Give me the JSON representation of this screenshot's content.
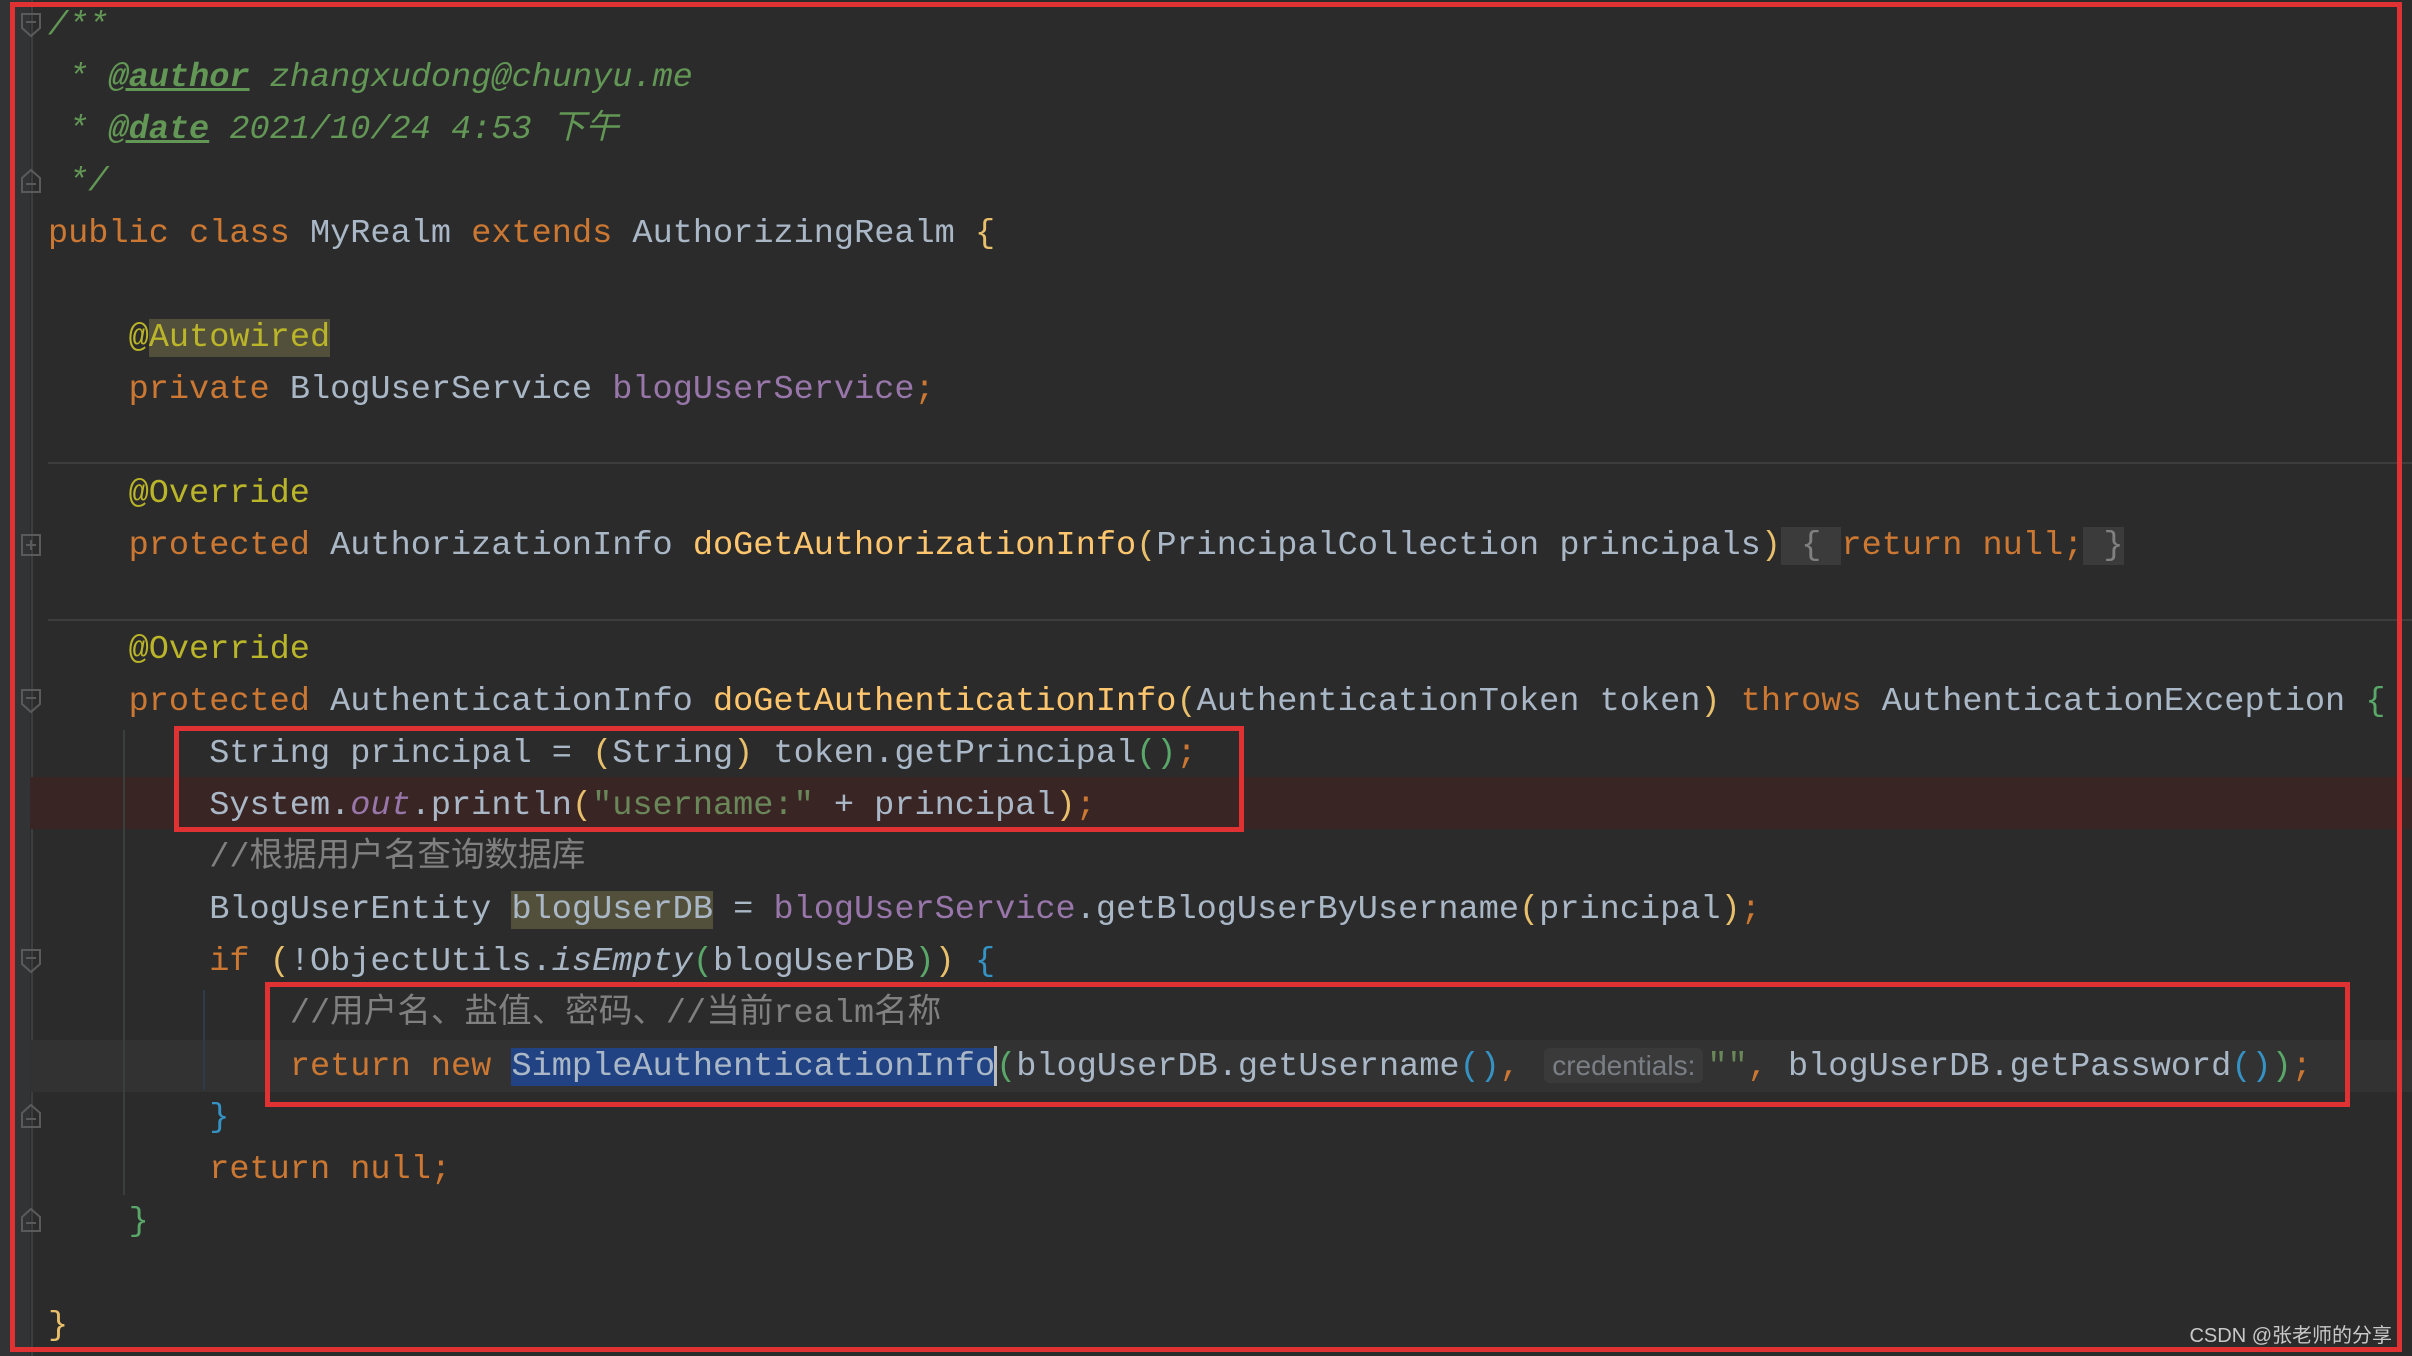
{
  "editor": {
    "theme": "IntelliJ Darcula",
    "lines": {
      "l1": "/**",
      "l2_star": " * ",
      "l2_tag": "@author",
      "l2_val": " zhangxudong@chunyu.me",
      "l3_star": " * ",
      "l3_tag": "@date",
      "l3_val": " 2021/10/24 4:53 下午",
      "l4": " */",
      "l5_public": "public",
      "l5_class": "class",
      "l5_name": "MyRealm",
      "l5_extends": "extends",
      "l5_super": "AuthorizingRealm",
      "l5_brace": "{",
      "l7_at": "@",
      "l7_ann": "Autowired",
      "l8_private": "private",
      "l8_type": "BlogUserService",
      "l8_field": "blogUserService",
      "l8_semi": ";",
      "l10_ann": "@Override",
      "l11_protected": "protected",
      "l11_type": "AuthorizationInfo",
      "l11_method": "doGetAuthorizationInfo",
      "l11_params": "PrincipalCollection principals",
      "l11_fold_open": " { ",
      "l11_body": "return null;",
      "l11_fold_close": " }",
      "l13_ann": "@Override",
      "l14_protected": "protected",
      "l14_type": "AuthenticationInfo",
      "l14_method": "doGetAuthenticationInfo",
      "l14_params": "AuthenticationToken token",
      "l14_throws": "throws",
      "l14_exc": "AuthenticationException",
      "l14_brace": "{",
      "l15_a": "String principal = ",
      "l15_cast": "String",
      "l15_b": " token.getPrincipal",
      "l16_a": "System.",
      "l16_out": "out",
      "l16_b": ".println",
      "l16_str": "\"username:\"",
      "l16_c": " + principal",
      "l17_cmt": "//根据用户名查询数据库",
      "l18_type": "BlogUserEntity ",
      "l18_var": "blogUserDB",
      "l18_eq": " = ",
      "l18_field": "blogUserService",
      "l18_call": ".getBlogUserByUsername",
      "l18_arg": "principal",
      "l19_if": "if",
      "l19_a": "!ObjectUtils.",
      "l19_isEmpty": "isEmpty",
      "l19_arg": "blogUserDB",
      "l20_cmt": "//用户名、盐值、密码、//当前realm名称",
      "l21_return": "return",
      "l21_new": "new",
      "l21_cls": "SimpleAuthenticationInfo",
      "l21_a": "blogUserDB.getUsername",
      "l21_hint": "credentials:",
      "l21_str": "\"\"",
      "l21_b": " blogUserDB.getPassword",
      "l22_brace": "}",
      "l23_return": "return null;",
      "l24_brace": "}",
      "l26_brace": "}"
    }
  },
  "annotations": {
    "highlight_color": "#e03232"
  },
  "watermark": "CSDN @张老师的分享"
}
